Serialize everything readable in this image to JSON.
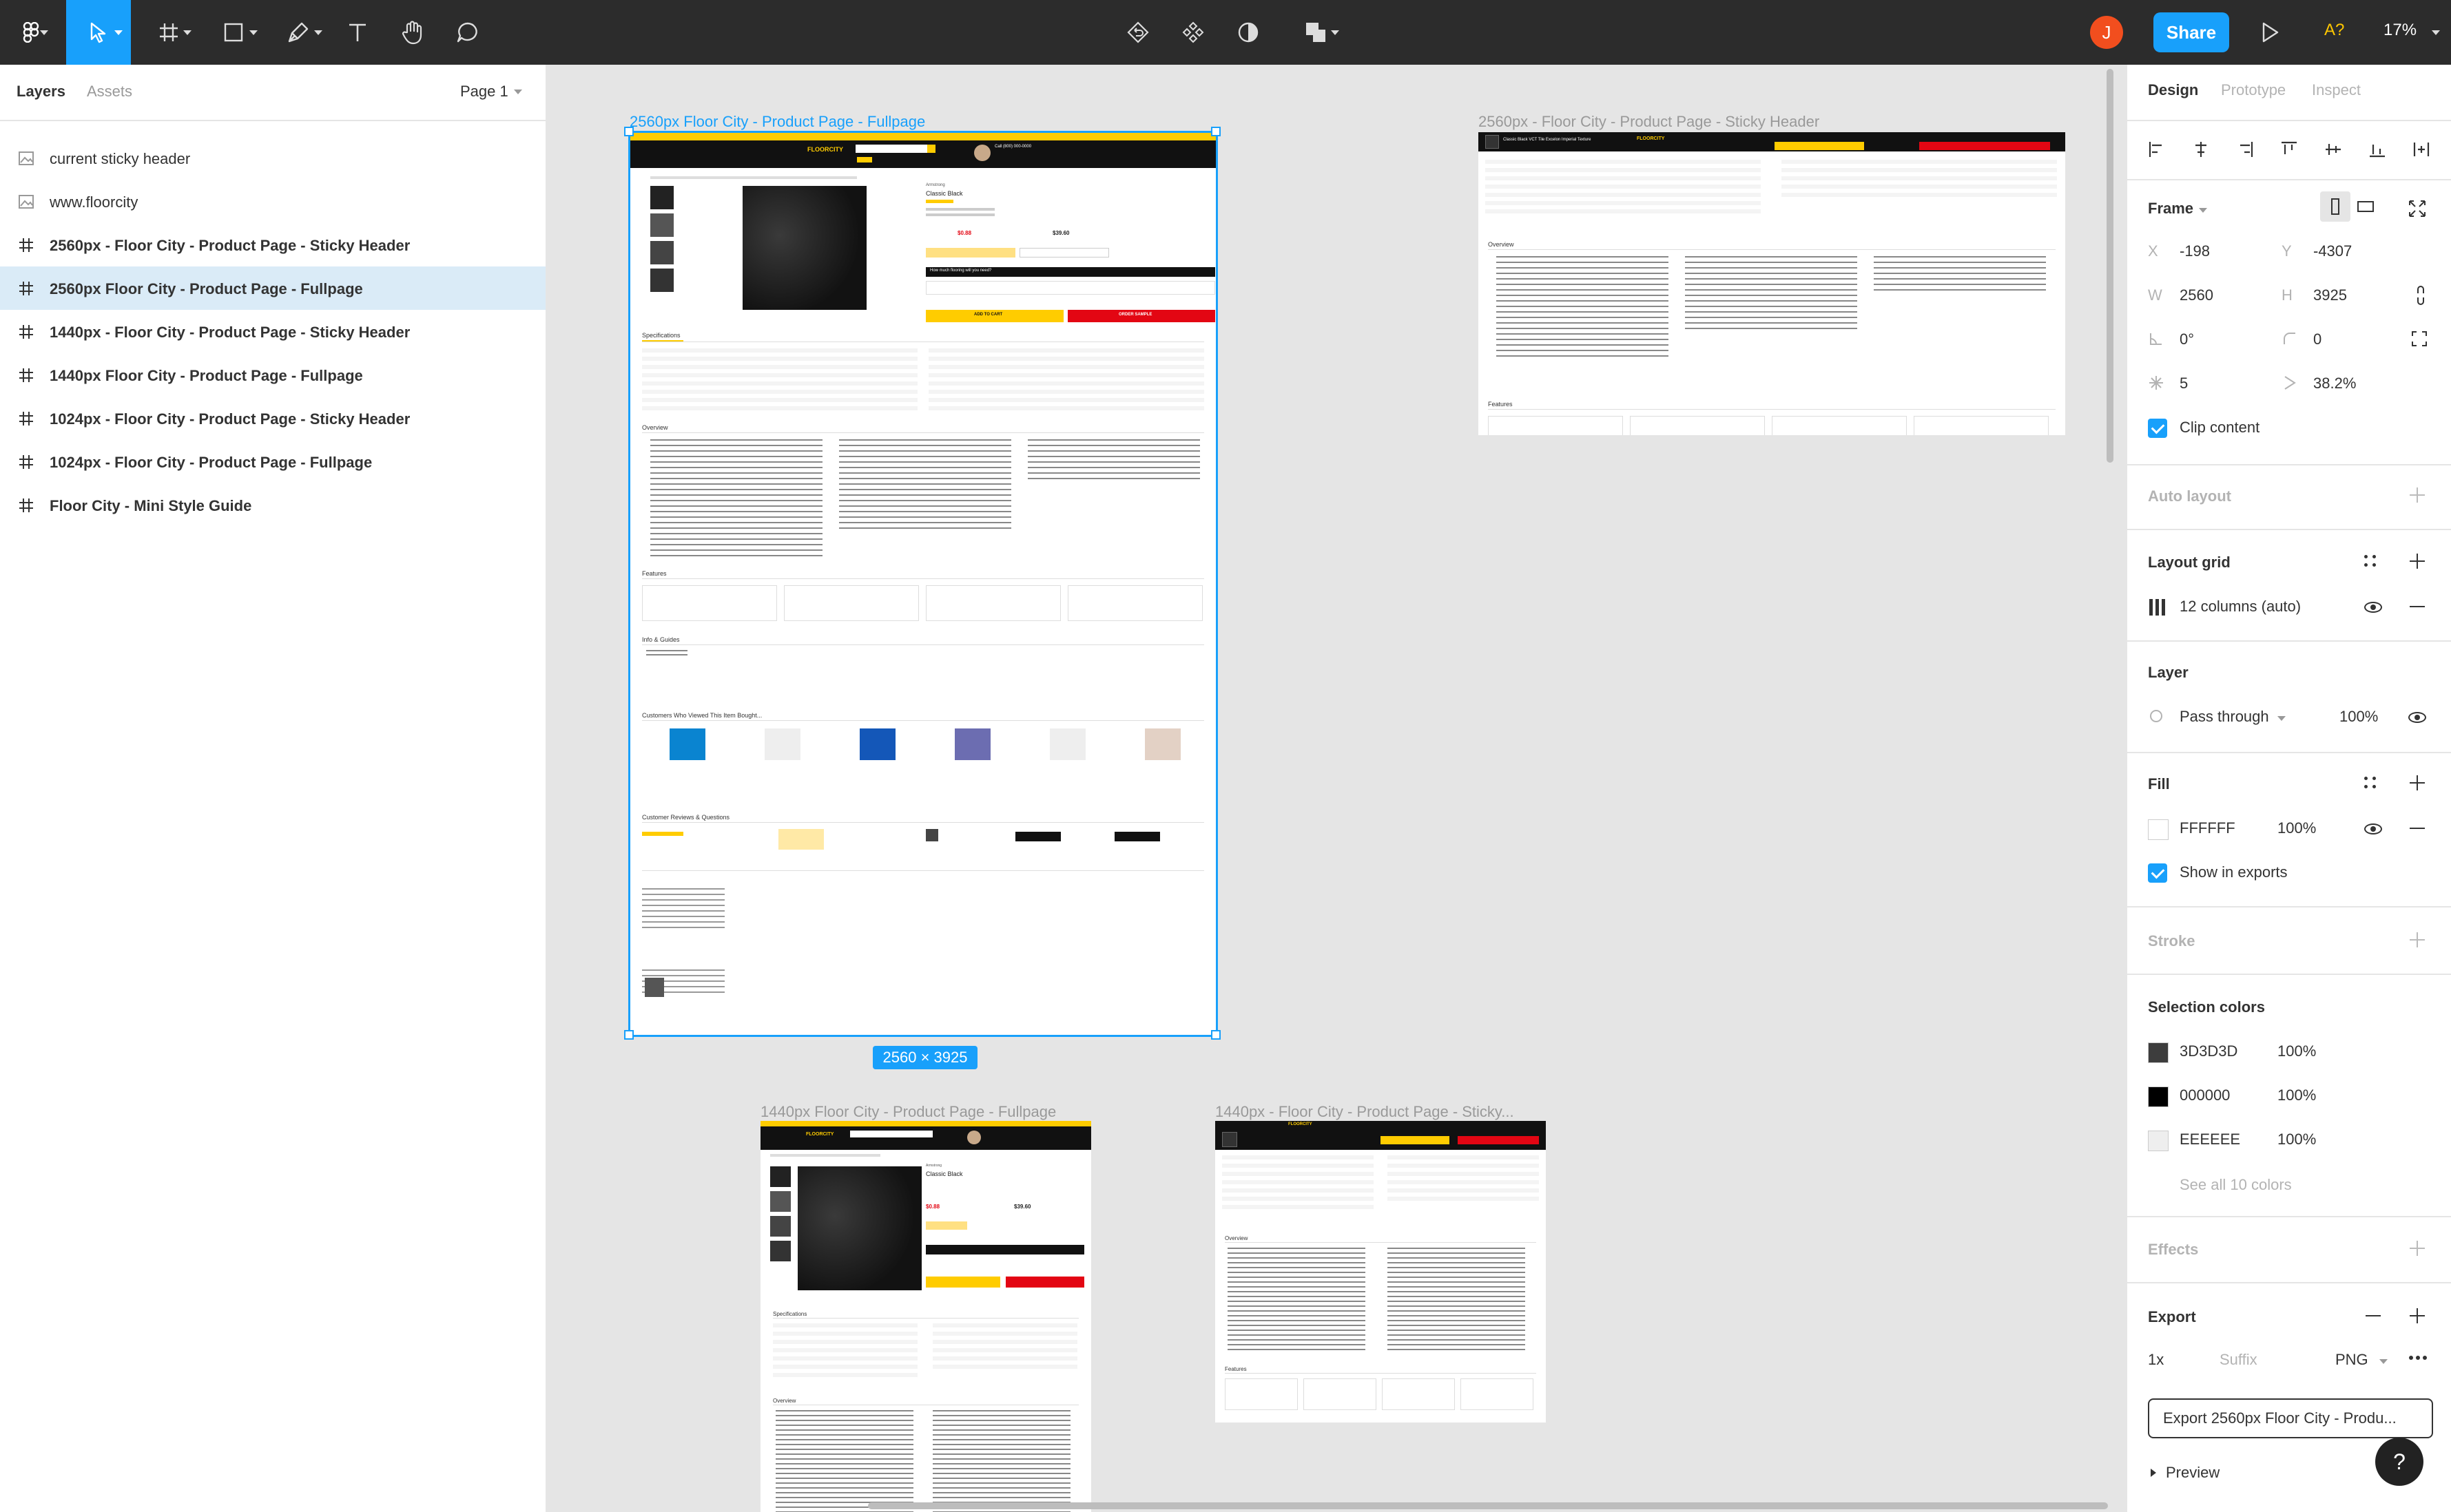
{
  "toolbar": {
    "share_label": "Share",
    "avatar_initial": "J",
    "font_badge": "A?",
    "zoom": "17%"
  },
  "layers_panel": {
    "tab_layers": "Layers",
    "tab_assets": "Assets",
    "page": "Page 1",
    "items": [
      {
        "label": "current sticky header",
        "type": "image"
      },
      {
        "label": "www.floorcity",
        "type": "image"
      },
      {
        "label": "2560px - Floor City - Product Page - Sticky Header",
        "type": "frame"
      },
      {
        "label": "2560px Floor City - Product Page - Fullpage",
        "type": "frame",
        "selected": true
      },
      {
        "label": "1440px - Floor City - Product Page - Sticky Header",
        "type": "frame"
      },
      {
        "label": "1440px Floor City - Product Page - Fullpage",
        "type": "frame"
      },
      {
        "label": "1024px - Floor City - Product Page - Sticky Header",
        "type": "frame"
      },
      {
        "label": "1024px - Floor City - Product Page - Fullpage",
        "type": "frame"
      },
      {
        "label": "Floor City - Mini Style Guide",
        "type": "frame"
      }
    ]
  },
  "canvas": {
    "frames": [
      {
        "label": "2560px Floor City - Product Page - Fullpage",
        "selected": true
      },
      {
        "label": "2560px - Floor City - Product Page - Sticky Header"
      },
      {
        "label": "1440px Floor City - Product Page - Fullpage"
      },
      {
        "label": "1440px - Floor City - Product Page - Sticky..."
      }
    ],
    "selection_size": "2560 × 3925",
    "thumbnail_text": {
      "brand": "FLOORCITY",
      "phone": "Call (800) 000-0000",
      "product_brand": "Armstrong",
      "product_name": "Classic Black",
      "price_1": "$0.88",
      "price_2": "$39.60",
      "how_much": "How much flooring will you need?",
      "add_to_cart": "ADD TO CART",
      "order_sample": "ORDER SAMPLE",
      "specifications": "Specifications",
      "overview": "Overview",
      "features": "Features",
      "info_guides": "Info & Guides",
      "customers_viewed": "Customers Who Viewed This Item Bought...",
      "reviews": "Customer Reviews & Questions",
      "sticky_title": "Classic Black VCT Tile Excelon Imperial Texture"
    }
  },
  "design_panel": {
    "tabs": [
      "Design",
      "Prototype",
      "Inspect"
    ],
    "frame_label": "Frame",
    "x_label": "X",
    "x": "-198",
    "y_label": "Y",
    "y": "-4307",
    "w_label": "W",
    "w": "2560",
    "h_label": "H",
    "h": "3925",
    "rotation": "0°",
    "radius": "0",
    "star_count": "5",
    "ratio": "38.2%",
    "clip_content": "Clip content",
    "auto_layout": "Auto layout",
    "layout_grid": "Layout grid",
    "grid_value": "12 columns (auto)",
    "layer": "Layer",
    "blend": "Pass through",
    "layer_opacity": "100%",
    "fill": "Fill",
    "fill_hex": "FFFFFF",
    "fill_opacity": "100%",
    "show_in_exports": "Show in exports",
    "stroke": "Stroke",
    "selection_colors": "Selection colors",
    "colors": [
      {
        "hex": "3D3D3D",
        "opacity": "100%",
        "color": "#3d3d3d"
      },
      {
        "hex": "000000",
        "opacity": "100%",
        "color": "#000000"
      },
      {
        "hex": "EEEEEE",
        "opacity": "100%",
        "color": "#eeeeee"
      }
    ],
    "see_all": "See all 10 colors",
    "effects": "Effects",
    "export": "Export",
    "export_scale": "1x",
    "export_suffix": "Suffix",
    "export_format": "PNG",
    "export_button": "Export 2560px Floor City - Produ...",
    "preview": "Preview",
    "help": "?"
  },
  "colors": {
    "accent": "#18a0fb",
    "toolbar": "#2c2c2c",
    "brand_yellow": "#ffcc00",
    "brand_red": "#e30613"
  }
}
